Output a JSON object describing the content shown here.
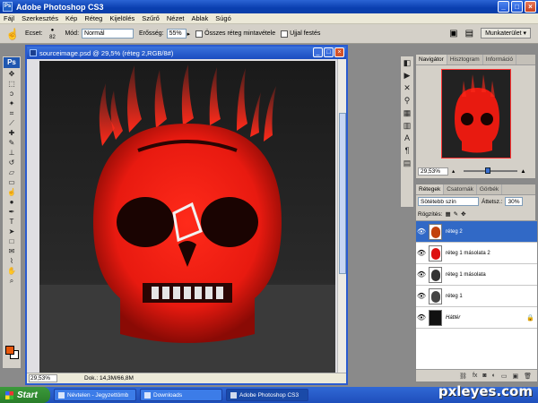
{
  "app": {
    "title": "Adobe Photoshop CS3",
    "icon_text": "Ps"
  },
  "menu": [
    "Fájl",
    "Szerkesztés",
    "Kép",
    "Réteg",
    "Kijelölés",
    "Szűrő",
    "Nézet",
    "Ablak",
    "Súgó"
  ],
  "options": {
    "brush_label": "Ecset:",
    "brush_size": "82",
    "mode_label": "Mód:",
    "mode_value": "Normál",
    "strength_label": "Erősség:",
    "strength_value": "55%",
    "sample_all_label": "Összes réteg mintavétele",
    "finger_label": "Ujjal festés",
    "workspace_label": "Munkaterület ▾"
  },
  "toolbox": {
    "logo": "Ps",
    "tools": [
      "move-icon",
      "marquee-icon",
      "lasso-icon",
      "magic-wand-icon",
      "crop-icon",
      "slice-icon",
      "healing-icon",
      "brush-icon",
      "stamp-icon",
      "history-brush-icon",
      "eraser-icon",
      "gradient-icon",
      "smudge-icon",
      "dodge-icon",
      "pen-icon",
      "type-icon",
      "path-select-icon",
      "shape-icon",
      "notes-icon",
      "eyedropper-icon",
      "hand-icon",
      "zoom-icon"
    ],
    "fg_color": "#e8580c",
    "bg_color": "#ffffff"
  },
  "document": {
    "title": "sourceimage.psd @ 29,5% (réteg 2,RGB/8#)",
    "zoom": "29,53%",
    "doc_info": "Dok.: 14,3M/66,8M"
  },
  "navigator": {
    "tabs": [
      "Navigátor",
      "Hisztogram",
      "Információ"
    ],
    "zoom": "29,53%"
  },
  "layers": {
    "tabs": [
      "Rétegek",
      "Csatornák",
      "Görbék"
    ],
    "blend_mode": "Sötétebb szín",
    "opacity_label": "Áttetsz.:",
    "opacity_value": "30%",
    "lock_label": "Rögzítés:",
    "items": [
      {
        "name": "réteg 2",
        "selected": true,
        "italic": false
      },
      {
        "name": "réteg 1 másolata 2",
        "selected": false,
        "italic": false
      },
      {
        "name": "réteg 1 másolata",
        "selected": false,
        "italic": false
      },
      {
        "name": "réteg 1",
        "selected": false,
        "italic": false
      },
      {
        "name": "Háttér",
        "selected": false,
        "italic": true
      }
    ]
  },
  "taskbar": {
    "start": "Start",
    "buttons": [
      "Névtelen - Jegyzettömb",
      "Downloads",
      "Adobe Photoshop CS3"
    ]
  },
  "watermark": "pxleyes.com"
}
